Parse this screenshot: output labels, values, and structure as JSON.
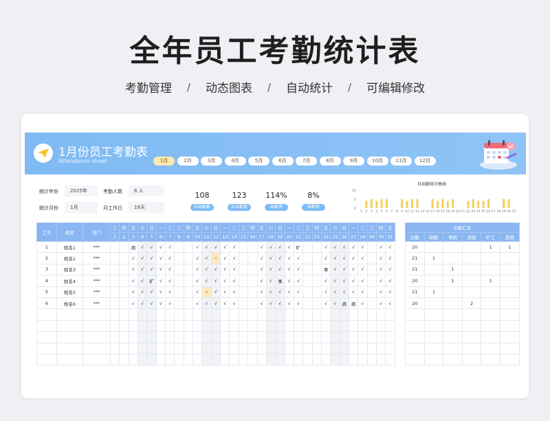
{
  "page": {
    "title": "全年员工考勤统计表",
    "subtitle": [
      "考勤管理",
      "动态图表",
      "自动统计",
      "可编辑修改"
    ],
    "subtitle_separator": "/"
  },
  "sheet": {
    "title": "1月份员工考勤表",
    "subtitle": "Attendance sheet",
    "months": [
      "1月",
      "2月",
      "3月",
      "4月",
      "5月",
      "6月",
      "7月",
      "8月",
      "9月",
      "10月",
      "11月",
      "12月"
    ],
    "active_month_index": 0
  },
  "info": {
    "year_label": "统计年份",
    "year_value": "2025年",
    "count_label": "考勤人数",
    "count_value": "6 人",
    "month_label": "统计月份",
    "month_value": "1月",
    "workdays_label": "月工作日",
    "workdays_value": "18天"
  },
  "stats": [
    {
      "value": "108",
      "label": "应出勤数"
    },
    {
      "value": "123",
      "label": "实出勤数"
    },
    {
      "value": "114%",
      "label": "出勤率"
    },
    {
      "value": "8%",
      "label": "缺勤率"
    }
  ],
  "chart_data": {
    "type": "bar",
    "title": "日出勤统计曲线",
    "categories": [
      "1",
      "2",
      "3",
      "4",
      "5",
      "6",
      "7",
      "8",
      "9",
      "10",
      "11",
      "12",
      "13",
      "14",
      "15",
      "16",
      "17",
      "18",
      "19",
      "20",
      "21",
      "22",
      "23",
      "24",
      "25",
      "26",
      "27",
      "28",
      "29",
      "30",
      "31"
    ],
    "values": [
      0,
      4,
      5,
      4,
      5,
      5,
      0,
      0,
      5,
      4,
      5,
      5,
      0,
      0,
      5,
      4,
      5,
      4,
      5,
      0,
      0,
      4,
      5,
      4,
      4,
      5,
      0,
      0,
      5,
      5,
      0
    ],
    "ylim": [
      0,
      10
    ],
    "y_ticks": [
      "0",
      "5",
      "10"
    ],
    "bar_color": "#f5cf5a",
    "grid": false
  },
  "table": {
    "headers": {
      "id": "工号",
      "name": "姓名",
      "dept": "部门"
    },
    "weekdays": [
      "三",
      "四",
      "五",
      "六",
      "日",
      "一",
      "二",
      "三",
      "四",
      "五",
      "六",
      "日",
      "一",
      "二",
      "三",
      "四",
      "五",
      "六",
      "日",
      "一",
      "二",
      "三",
      "四",
      "五",
      "六",
      "日",
      "一",
      "二",
      "三",
      "四",
      "五"
    ],
    "days": [
      "1",
      "2",
      "3",
      "4",
      "5",
      "6",
      "7",
      "8",
      "9",
      "10",
      "11",
      "12",
      "13",
      "14",
      "15",
      "16",
      "17",
      "18",
      "19",
      "20",
      "21",
      "22",
      "23",
      "24",
      "25",
      "26",
      "27",
      "28",
      "29",
      "30",
      "31"
    ],
    "rows": [
      {
        "id": "1",
        "name": "姓名1",
        "dept": "***",
        "marks": [
          "",
          "",
          "病",
          "√",
          "√",
          "√",
          "√",
          "",
          "",
          "√",
          "√",
          "√",
          "√",
          "√",
          "",
          "",
          "√",
          "√",
          "√",
          "√",
          "旷",
          "",
          "",
          "√",
          "√",
          "√",
          "√",
          "√",
          "",
          "√",
          "√"
        ]
      },
      {
        "id": "2",
        "name": "姓名2",
        "dept": "***",
        "marks": [
          "",
          "",
          "√",
          "√",
          "√",
          "√",
          "√",
          "",
          "",
          "√",
          "√",
          "×",
          "√",
          "√",
          "",
          "",
          "√",
          "√",
          "√",
          "√",
          "√",
          "",
          "",
          "√",
          "√",
          "√",
          "√",
          "√",
          "",
          "√",
          "√"
        ]
      },
      {
        "id": "3",
        "name": "姓名3",
        "dept": "***",
        "marks": [
          "",
          "",
          "√",
          "√",
          "√",
          "√",
          "√",
          "",
          "",
          "√",
          "√",
          "√",
          "√",
          "√",
          "",
          "",
          "√",
          "√",
          "√",
          "√",
          "√",
          "",
          "",
          "事",
          "√",
          "√",
          "√",
          "√",
          "",
          "√",
          "√"
        ]
      },
      {
        "id": "4",
        "name": "姓名4",
        "dept": "***",
        "marks": [
          "",
          "",
          "√",
          "√",
          "旷",
          "√",
          "√",
          "",
          "",
          "√",
          "√",
          "√",
          "√",
          "√",
          "",
          "",
          "√",
          "√",
          "事",
          "√",
          "√",
          "",
          "",
          "√",
          "√",
          "√",
          "√",
          "√",
          "",
          "√",
          "√"
        ]
      },
      {
        "id": "5",
        "name": "姓名5",
        "dept": "***",
        "marks": [
          "",
          "",
          "√",
          "√",
          "√",
          "√",
          "√",
          "",
          "",
          "√",
          "×",
          "√",
          "√",
          "√",
          "",
          "",
          "√",
          "√",
          "√",
          "√",
          "√",
          "",
          "",
          "√",
          "√",
          "√",
          "√",
          "√",
          "",
          "√",
          "√"
        ]
      },
      {
        "id": "6",
        "name": "姓名6",
        "dept": "***",
        "marks": [
          "",
          "",
          "√",
          "√",
          "√",
          "√",
          "√",
          "",
          "",
          "√",
          "√",
          "√",
          "√",
          "√",
          "",
          "",
          "√",
          "√",
          "√",
          "√",
          "√",
          "",
          "",
          "√",
          "√",
          "病",
          "病",
          "√",
          "",
          "√",
          "√"
        ]
      }
    ],
    "highlight": [
      [
        1,
        11
      ],
      [
        4,
        10
      ]
    ]
  },
  "summary": {
    "title": "出勤汇总",
    "headers": [
      "出勤",
      "缺勤",
      "事假",
      "病假",
      "旷工",
      "其他"
    ],
    "rows": [
      [
        "20",
        "",
        "",
        "",
        "1",
        "1"
      ],
      [
        "21",
        "1",
        "",
        "",
        "",
        ""
      ],
      [
        "21",
        "",
        "1",
        "",
        "",
        ""
      ],
      [
        "20",
        "",
        "1",
        "",
        "1",
        ""
      ],
      [
        "21",
        "1",
        "",
        "",
        "",
        ""
      ],
      [
        "20",
        "",
        "",
        "2",
        "",
        ""
      ]
    ]
  }
}
